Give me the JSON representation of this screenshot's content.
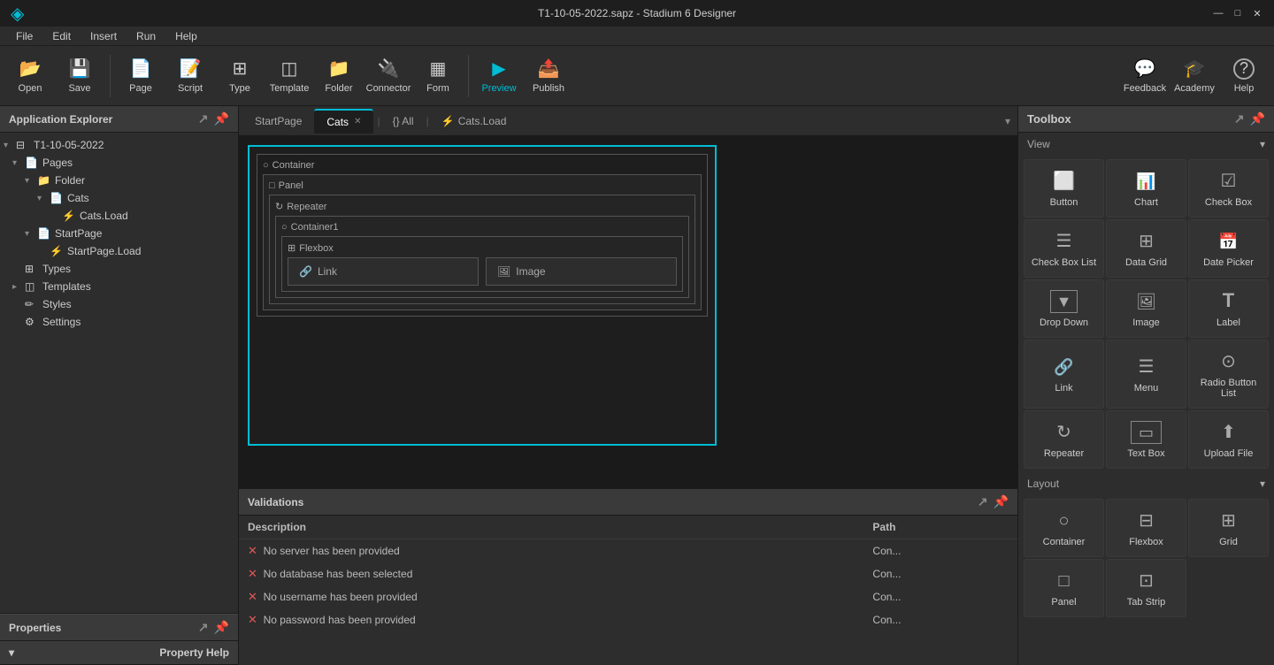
{
  "titlebar": {
    "title": "T1-10-05-2022.sapz - Stadium 6 Designer",
    "min_label": "—",
    "max_label": "□",
    "close_label": "✕"
  },
  "menubar": {
    "items": [
      {
        "label": "File"
      },
      {
        "label": "Edit"
      },
      {
        "label": "Insert"
      },
      {
        "label": "Run"
      },
      {
        "label": "Help"
      }
    ]
  },
  "toolbar": {
    "items": [
      {
        "id": "open",
        "label": "Open",
        "icon": "📂"
      },
      {
        "id": "save",
        "label": "Save",
        "icon": "💾"
      },
      {
        "id": "page",
        "label": "Page",
        "icon": "📄"
      },
      {
        "id": "script",
        "label": "Script",
        "icon": "📝"
      },
      {
        "id": "type",
        "label": "Type",
        "icon": "⊞"
      },
      {
        "id": "template",
        "label": "Template",
        "icon": "◫"
      },
      {
        "id": "folder",
        "label": "Folder",
        "icon": "📁"
      },
      {
        "id": "connector",
        "label": "Connector",
        "icon": "🔌"
      },
      {
        "id": "form",
        "label": "Form",
        "icon": "▦"
      },
      {
        "id": "preview",
        "label": "Preview",
        "icon": "▶"
      },
      {
        "id": "publish",
        "label": "Publish",
        "icon": "📤"
      }
    ],
    "right_items": [
      {
        "id": "feedback",
        "label": "Feedback",
        "icon": "💬"
      },
      {
        "id": "academy",
        "label": "Academy",
        "icon": "🎓"
      },
      {
        "id": "help",
        "label": "Help",
        "icon": "?"
      }
    ]
  },
  "left_panel": {
    "title": "Application Explorer",
    "tree": [
      {
        "id": "root",
        "indent": 0,
        "expand": "▾",
        "icon": "⊟",
        "label": "T1-10-05-2022",
        "type": "app"
      },
      {
        "id": "pages",
        "indent": 1,
        "expand": "▾",
        "icon": "📄",
        "label": "Pages",
        "type": "pages"
      },
      {
        "id": "folder",
        "indent": 2,
        "expand": "▾",
        "icon": "📁",
        "label": "Folder",
        "type": "folder"
      },
      {
        "id": "cats",
        "indent": 3,
        "expand": "▾",
        "icon": "📄",
        "label": "Cats",
        "type": "page"
      },
      {
        "id": "catsload",
        "indent": 4,
        "expand": "",
        "icon": "⚡",
        "label": "Cats.Load",
        "type": "event"
      },
      {
        "id": "startpage",
        "indent": 2,
        "expand": "▾",
        "icon": "📄",
        "label": "StartPage",
        "type": "page"
      },
      {
        "id": "startpageload",
        "indent": 3,
        "expand": "",
        "icon": "⚡",
        "label": "StartPage.Load",
        "type": "event"
      },
      {
        "id": "types",
        "indent": 1,
        "expand": "",
        "icon": "⊞",
        "label": "Types",
        "type": "types"
      },
      {
        "id": "templates",
        "indent": 1,
        "expand": "▸",
        "icon": "◫",
        "label": "Templates",
        "type": "templates"
      },
      {
        "id": "styles",
        "indent": 1,
        "expand": "",
        "icon": "✏",
        "label": "Styles",
        "type": "styles"
      },
      {
        "id": "settings",
        "indent": 1,
        "expand": "",
        "icon": "⚙",
        "label": "Settings",
        "type": "settings"
      }
    ]
  },
  "properties_panel": {
    "title": "Properties",
    "property_help_label": "Property Help"
  },
  "tabs": {
    "items": [
      {
        "id": "startpage",
        "label": "StartPage",
        "active": false,
        "closable": false
      },
      {
        "id": "cats",
        "label": "Cats",
        "active": true,
        "closable": true
      },
      {
        "id": "all",
        "label": "{} All",
        "active": false,
        "closable": false
      },
      {
        "id": "catsload",
        "label": "⚡ Cats.Load",
        "active": false,
        "closable": false
      }
    ]
  },
  "canvas": {
    "elements": [
      {
        "type": "container",
        "label": "Container",
        "icon": "○"
      },
      {
        "type": "panel",
        "label": "Panel",
        "icon": "□"
      },
      {
        "type": "repeater",
        "label": "Repeater",
        "icon": "↻"
      },
      {
        "type": "container1",
        "label": "Container1",
        "icon": "○"
      },
      {
        "type": "flexbox",
        "label": "Flexbox",
        "icon": "⊞"
      },
      {
        "type": "link",
        "label": "Link",
        "icon": "🔗"
      },
      {
        "type": "image",
        "label": "Image",
        "icon": "🖼"
      }
    ]
  },
  "validations": {
    "title": "Validations",
    "columns": [
      {
        "id": "description",
        "label": "Description"
      },
      {
        "id": "path",
        "label": "Path"
      }
    ],
    "rows": [
      {
        "description": "No server has been provided",
        "path": "Con..."
      },
      {
        "description": "No database has been selected",
        "path": "Con..."
      },
      {
        "description": "No username has been provided",
        "path": "Con..."
      },
      {
        "description": "No password has been provided",
        "path": "Con..."
      }
    ]
  },
  "toolbox": {
    "title": "Toolbox",
    "sections": [
      {
        "id": "view",
        "label": "View",
        "expanded": true,
        "items": [
          {
            "id": "button",
            "label": "Button",
            "icon_class": "ti-button"
          },
          {
            "id": "chart",
            "label": "Chart",
            "icon_class": "ti-chart"
          },
          {
            "id": "checkbox",
            "label": "Check Box",
            "icon_class": "ti-checkbox"
          },
          {
            "id": "checkboxlist",
            "label": "Check Box List",
            "icon_class": "ti-checkboxlist"
          },
          {
            "id": "datagrid",
            "label": "Data Grid",
            "icon_class": "ti-datagrid"
          },
          {
            "id": "datepicker",
            "label": "Date Picker",
            "icon_class": "ti-datepicker"
          },
          {
            "id": "dropdown",
            "label": "Drop Down",
            "icon_class": "ti-dropdown"
          },
          {
            "id": "image",
            "label": "Image",
            "icon_class": "ti-image"
          },
          {
            "id": "label",
            "label": "Label",
            "icon_class": "ti-label"
          },
          {
            "id": "link",
            "label": "Link",
            "icon_class": "ti-link"
          },
          {
            "id": "menu",
            "label": "Menu",
            "icon_class": "ti-menu"
          },
          {
            "id": "radiobtnlist",
            "label": "Radio Button List",
            "icon_class": "ti-radiobtnlist"
          },
          {
            "id": "repeater",
            "label": "Repeater",
            "icon_class": "ti-repeater"
          },
          {
            "id": "textbox",
            "label": "Text Box",
            "icon_class": "ti-textbox"
          },
          {
            "id": "uploadfile",
            "label": "Upload File",
            "icon_class": "ti-uploadfile"
          }
        ]
      },
      {
        "id": "layout",
        "label": "Layout",
        "expanded": true,
        "items": [
          {
            "id": "container",
            "label": "Container",
            "icon_class": "ti-container"
          },
          {
            "id": "flexbox",
            "label": "Flexbox",
            "icon_class": "ti-flexbox"
          },
          {
            "id": "grid",
            "label": "Grid",
            "icon_class": "ti-grid"
          },
          {
            "id": "panel",
            "label": "Panel",
            "icon_class": "ti-panel"
          },
          {
            "id": "tabstrip",
            "label": "Tab Strip",
            "icon_class": "ti-tabstrip"
          }
        ]
      }
    ]
  }
}
